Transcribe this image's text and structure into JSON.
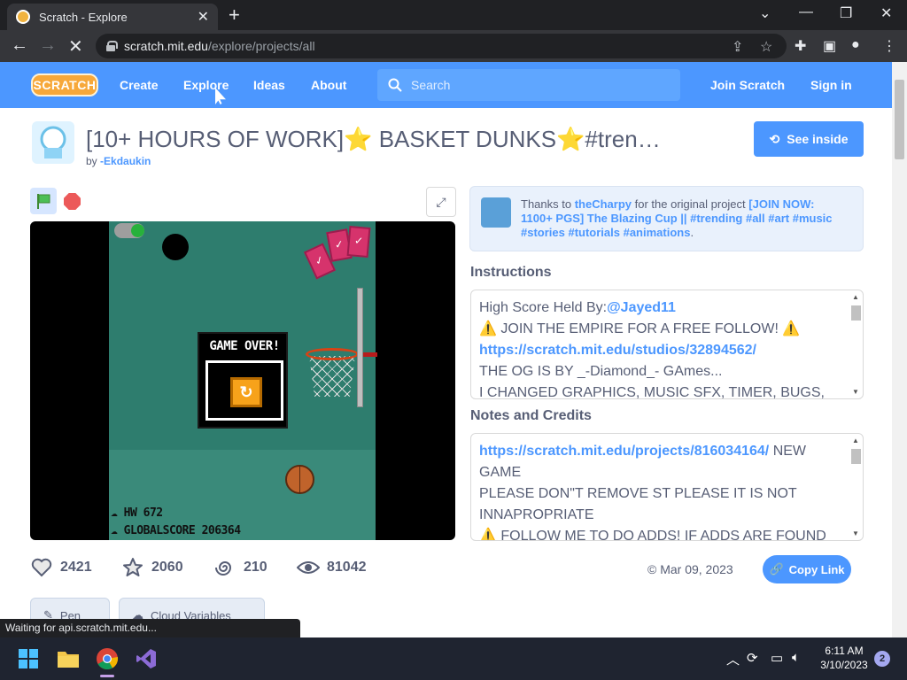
{
  "browser": {
    "tab_title": "Scratch - Explore",
    "url_host": "scratch.mit.edu",
    "url_path": "/explore/projects/all",
    "status_text": "Waiting for api.scratch.mit.edu..."
  },
  "nav": {
    "logo": "SCRATCH",
    "links": [
      "Create",
      "Explore",
      "Ideas",
      "About"
    ],
    "search_placeholder": "Search",
    "join": "Join Scratch",
    "signin": "Sign in"
  },
  "project": {
    "title": "[10+ HOURS OF WORK]⭐ BASKET DUNKS⭐#tren…",
    "by_prefix": "by",
    "author": "-Ekdaukin",
    "see_inside": "See inside"
  },
  "stage": {
    "gameover": "GAME OVER!",
    "hud_hw": "HW 672",
    "hud_score": "GLOBALSCORE 206364"
  },
  "remix": {
    "thanks_prefix": "Thanks to",
    "user": "theCharpy",
    "middle": "for the original project",
    "project": "[JOIN NOW: 1100+ PGS] The Blazing Cup || #trending #all #art #music #stories #tutorials #animations",
    "end": "."
  },
  "instructions": {
    "title": "Instructions",
    "line1_prefix": "High Score Held By:",
    "line1_user": "@Jayed11",
    "line2": "⚠️ JOIN THE EMPIRE FOR A FREE FOLLOW! ⚠️",
    "line3": "https://scratch.mit.edu/studios/32894562/",
    "line4": "THE OG IS BY _-Diamond_- GAmes...",
    "line5": "I CHANGED GRAPHICS, MUSIC SFX, TIMER, BUGS,"
  },
  "notes": {
    "title": "Notes and Credits",
    "link": "https://scratch.mit.edu/projects/816034164/",
    "link_suffix": "NEW GAME",
    "line2": "PLEASE DON\"T REMOVE ST PLEASE IT IS NOT INNAPROPRIATE",
    "line3": "⚠️ FOLLOW ME TO DO ADDS! IF ADDS ARE FOUND"
  },
  "stats": {
    "loves": "2421",
    "favorites": "2060",
    "remixes": "210",
    "views": "81042",
    "shared_date": "© Mar 09, 2023",
    "copy_link": "Copy Link"
  },
  "tags": [
    "Pen",
    "Cloud Variables"
  ],
  "taskbar": {
    "time": "6:11 AM",
    "date": "3/10/2023",
    "notifications": "2"
  }
}
